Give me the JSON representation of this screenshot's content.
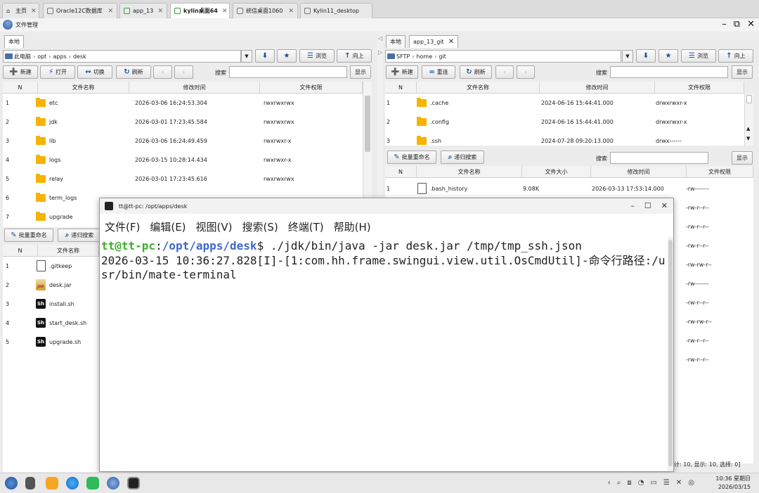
{
  "browser_tabs": [
    {
      "label": "主页",
      "icon": "home-icon"
    },
    {
      "label": "Oracle12C数据库",
      "icon": "window-icon"
    },
    {
      "label": "app_13",
      "icon": "terminal-icon"
    },
    {
      "label": "kylin桌面64",
      "icon": "terminal-icon",
      "active": true
    },
    {
      "label": "统信桌面1060",
      "icon": "window-icon"
    },
    {
      "label": "Kylin11_desktop",
      "icon": "window-icon"
    }
  ],
  "app": {
    "title": "文件管理"
  },
  "window_controls": {
    "minimize": "–",
    "restore": "⧉",
    "close": "✕"
  },
  "left": {
    "tab": "本地",
    "path": [
      "此电脑",
      "opt",
      "apps",
      "desk"
    ],
    "toolbar": {
      "new": "新建",
      "open": "打开",
      "switch": "切换",
      "refresh": "刷新",
      "browse": "浏览",
      "up": "向上",
      "search": "搜索",
      "show": "显示"
    },
    "columns": [
      "N",
      "文件名称",
      "修改时间",
      "文件权限"
    ],
    "rows": [
      {
        "n": "1",
        "name": "etc",
        "time": "2026-03-06 16:24:53.304",
        "perm": "rwxrwxrwx"
      },
      {
        "n": "2",
        "name": "jdk",
        "time": "2026-03-01 17:23:45.584",
        "perm": "rwxrwxrwx"
      },
      {
        "n": "3",
        "name": "lib",
        "time": "2026-03-06 16:24:49.459",
        "perm": "rwxrwxr-x"
      },
      {
        "n": "4",
        "name": "logs",
        "time": "2026-03-15 10:28:14.434",
        "perm": "rwxrwxr-x"
      },
      {
        "n": "5",
        "name": "relay",
        "time": "2026-03-01 17:23:45.616",
        "perm": "rwxrwxrwx"
      },
      {
        "n": "6",
        "name": "term_logs",
        "time": "",
        "perm": ""
      },
      {
        "n": "7",
        "name": "upgrade",
        "time": "",
        "perm": ""
      }
    ],
    "bottom_toolbar": {
      "rename": "批量重命名",
      "search": "递归搜索"
    },
    "bottom_columns": [
      "N",
      "文件名称"
    ],
    "files": [
      {
        "n": "1",
        "name": ".gitkeep",
        "type": "file"
      },
      {
        "n": "2",
        "name": "desk.jar",
        "type": "jar"
      },
      {
        "n": "3",
        "name": "install.sh",
        "type": "sh"
      },
      {
        "n": "4",
        "name": "start_desk.sh",
        "type": "sh"
      },
      {
        "n": "5",
        "name": "upgrade.sh",
        "type": "sh"
      }
    ]
  },
  "right": {
    "tabs": [
      "本地",
      "app_13_git"
    ],
    "path": [
      "SFTP",
      "home",
      "git"
    ],
    "toolbar": {
      "new": "新建",
      "reconnect": "重连",
      "refresh": "刷新",
      "browse": "浏览",
      "up": "向上",
      "search": "搜索",
      "show": "显示"
    },
    "columns": [
      "N",
      "文件名称",
      "修改时间",
      "文件权限"
    ],
    "rows": [
      {
        "n": "1",
        "name": ".cache",
        "time": "2024-06-16 15:44:41.000",
        "perm": "drwxrwxr-x"
      },
      {
        "n": "2",
        "name": ".config",
        "time": "2024-06-16 15:44:41.000",
        "perm": "drwxrwxr-x"
      },
      {
        "n": "3",
        "name": ".ssh",
        "time": "2024-07-28 09:20:13.000",
        "perm": "drwx------"
      }
    ],
    "bottom_toolbar": {
      "rename": "批量重命名",
      "search": "递归搜索",
      "search_label": "搜索",
      "show": "显示"
    },
    "bottom_columns": [
      "N",
      "文件名称",
      "文件大小",
      "修改时间",
      "文件权限"
    ],
    "files": [
      {
        "n": "1",
        "name": ".bash_history",
        "size": "9.08K",
        "time": "2026-03-13 17:53:14.000",
        "perm": "-rw-------"
      }
    ],
    "extra_perms": [
      "-rw-r--r--",
      "-rw-r--r--",
      "-rw-r--r--",
      "-rw-rw-r--",
      "-rw-------",
      "-rw-r--r--",
      "-rw-rw-r--",
      "-rw-r--r--",
      "-rw-r--r--"
    ],
    "status": "计: 10, 显示: 10, 选择: 0]"
  },
  "terminal": {
    "title": "tt@tt-pc: /opt/apps/desk",
    "menu": [
      "文件(F)",
      "编辑(E)",
      "视图(V)",
      "搜索(S)",
      "终端(T)",
      "帮助(H)"
    ],
    "prompt_user": "tt@tt-pc",
    "prompt_colon": ":",
    "prompt_path": "/opt/apps/desk",
    "prompt_dollar": "$ ",
    "command": "./jdk/bin/java -jar desk.jar /tmp/tmp_ssh.json",
    "output": "2026-03-15 10:36:27.828[I]-[1:com.hh.frame.swingui.view.util.OsCmdUtil]-命令行路径:/usr/bin/mate-terminal"
  },
  "taskbar": {
    "time": "10:36 星期日",
    "date": "2026/03/15",
    "apps": [
      "kylin-start-icon",
      "multitask-icon",
      "app-store-icon",
      "browser-icon",
      "chat-icon",
      "file-manager-icon",
      "terminal-icon"
    ],
    "tray": [
      "‹",
      "⌕",
      "⧈",
      "◔",
      "▭",
      "☰",
      "✕",
      "◎"
    ]
  }
}
